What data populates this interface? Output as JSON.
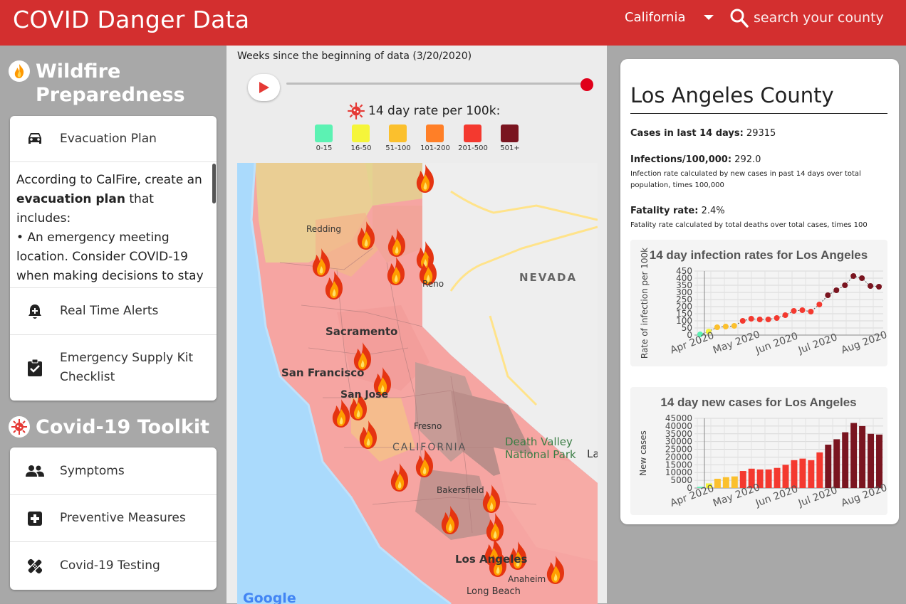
{
  "header": {
    "title": "COVID Danger Data",
    "state": "California",
    "search_placeholder": "search your county"
  },
  "sidebar": {
    "wildfire_title": "Wildfire Preparedness",
    "evacuation_label": "Evacuation Plan",
    "evacuation_text_1": "According to CalFire, create an ",
    "evacuation_text_bold": "evacuation plan",
    "evacuation_text_2": " that includes:",
    "evacuation_text_3": "• An emergency meeting location. Consider COVID-19 when making decisions to stay with relatives or friends. Ask first",
    "alerts_label": "Real Time Alerts",
    "supply_label": "Emergency Supply Kit Checklist",
    "covid_title": "Covid-19 Toolkit",
    "symptoms_label": "Symptoms",
    "preventive_label": "Preventive Measures",
    "testing_label": "Covid-19 Testing"
  },
  "timeline": {
    "label": "Weeks since the beginning of data (3/20/2020)",
    "position": 1.0
  },
  "legend": {
    "title": "14 day rate per 100k:",
    "items": [
      {
        "label": "0-15",
        "color": "#5cf2b3"
      },
      {
        "label": "16-50",
        "color": "#f5f53a"
      },
      {
        "label": "51-100",
        "color": "#fbc02d"
      },
      {
        "label": "101-200",
        "color": "#ff7f27"
      },
      {
        "label": "201-500",
        "color": "#f4392f"
      },
      {
        "label": "501+",
        "color": "#7a1520"
      }
    ]
  },
  "map": {
    "labels": {
      "redding": "Redding",
      "reno": "Reno",
      "nevada": "NEVADA",
      "sacramento": "Sacramento",
      "sanfrancisco": "San Francisco",
      "sanjose": "San Jose",
      "fresno": "Fresno",
      "california": "CALIFORNIA",
      "deathvalley": "Death Valley\nNational Park",
      "las": "La",
      "bakersfield": "Bakersfield",
      "losangeles": "Los Angeles",
      "anaheim": "Anaheim",
      "longbeach": "Long Beach",
      "google": "Google"
    }
  },
  "county": {
    "name": "Los Angeles County",
    "cases_label": "Cases in last 14 days:",
    "cases_value": "29315",
    "infections_label": "Infections/100,000:",
    "infections_value": "292.0",
    "infections_note": "Infection rate calculated by new cases in past 14 days over total population, times 100,000",
    "fatality_label": "Fatality rate:",
    "fatality_value": "2.4%",
    "fatality_note": "Fatality rate calculated by total deaths over total cases, times 100"
  },
  "chart_data": [
    {
      "type": "line",
      "title": "14 day infection rates for Los Angeles",
      "xlabel": "",
      "ylabel": "Rate of infection per 100k",
      "x_ticks": [
        "Apr 2020",
        "May 2020",
        "Jun 2020",
        "Jul 2020",
        "Aug 2020"
      ],
      "y_ticks": [
        0,
        50,
        100,
        150,
        200,
        250,
        300,
        350,
        400,
        450
      ],
      "ylim": [
        0,
        450
      ],
      "x": [
        "2020-03-27",
        "2020-04-03",
        "2020-04-10",
        "2020-04-17",
        "2020-04-24",
        "2020-05-01",
        "2020-05-08",
        "2020-05-15",
        "2020-05-22",
        "2020-05-29",
        "2020-06-05",
        "2020-06-12",
        "2020-06-19",
        "2020-06-26",
        "2020-07-03",
        "2020-07-10",
        "2020-07-17",
        "2020-07-24",
        "2020-07-31",
        "2020-08-07",
        "2020-08-14",
        "2020-08-21"
      ],
      "values": [
        5,
        25,
        55,
        60,
        65,
        100,
        115,
        110,
        110,
        120,
        140,
        170,
        175,
        165,
        215,
        280,
        315,
        350,
        415,
        400,
        345,
        340
      ],
      "colors": [
        "#5cf2b3",
        "#f5f53a",
        "#fbc02d",
        "#fbc02d",
        "#fbc02d",
        "#f4392f",
        "#f4392f",
        "#f4392f",
        "#f4392f",
        "#f4392f",
        "#f4392f",
        "#f4392f",
        "#f4392f",
        "#f4392f",
        "#f4392f",
        "#7a1520",
        "#7a1520",
        "#7a1520",
        "#7a1520",
        "#7a1520",
        "#7a1520",
        "#7a1520"
      ],
      "grid": true
    },
    {
      "type": "bar",
      "title": "14 day new cases for Los Angeles",
      "xlabel": "",
      "ylabel": "New cases",
      "x_ticks": [
        "Apr 2020",
        "May 2020",
        "Jun 2020",
        "Jul 2020",
        "Aug 2020"
      ],
      "y_ticks": [
        0,
        5000,
        10000,
        15000,
        20000,
        25000,
        30000,
        35000,
        40000,
        45000
      ],
      "ylim": [
        0,
        45000
      ],
      "x": [
        "2020-03-27",
        "2020-04-03",
        "2020-04-10",
        "2020-04-17",
        "2020-04-24",
        "2020-05-01",
        "2020-05-08",
        "2020-05-15",
        "2020-05-22",
        "2020-05-29",
        "2020-06-05",
        "2020-06-12",
        "2020-06-19",
        "2020-06-26",
        "2020-07-03",
        "2020-07-10",
        "2020-07-17",
        "2020-07-24",
        "2020-07-31",
        "2020-08-07",
        "2020-08-14",
        "2020-08-21"
      ],
      "values": [
        800,
        3000,
        6000,
        7000,
        7500,
        11000,
        12500,
        12000,
        12000,
        13000,
        15000,
        18000,
        19000,
        18000,
        23000,
        28000,
        31500,
        36000,
        42000,
        40000,
        35000,
        34500
      ],
      "colors": [
        "#5cf2b3",
        "#f5f53a",
        "#fbc02d",
        "#fbc02d",
        "#fbc02d",
        "#f4392f",
        "#f4392f",
        "#f4392f",
        "#f4392f",
        "#f4392f",
        "#f4392f",
        "#f4392f",
        "#f4392f",
        "#f4392f",
        "#f4392f",
        "#7a1520",
        "#7a1520",
        "#7a1520",
        "#7a1520",
        "#7a1520",
        "#7a1520",
        "#7a1520"
      ],
      "grid": true
    }
  ]
}
